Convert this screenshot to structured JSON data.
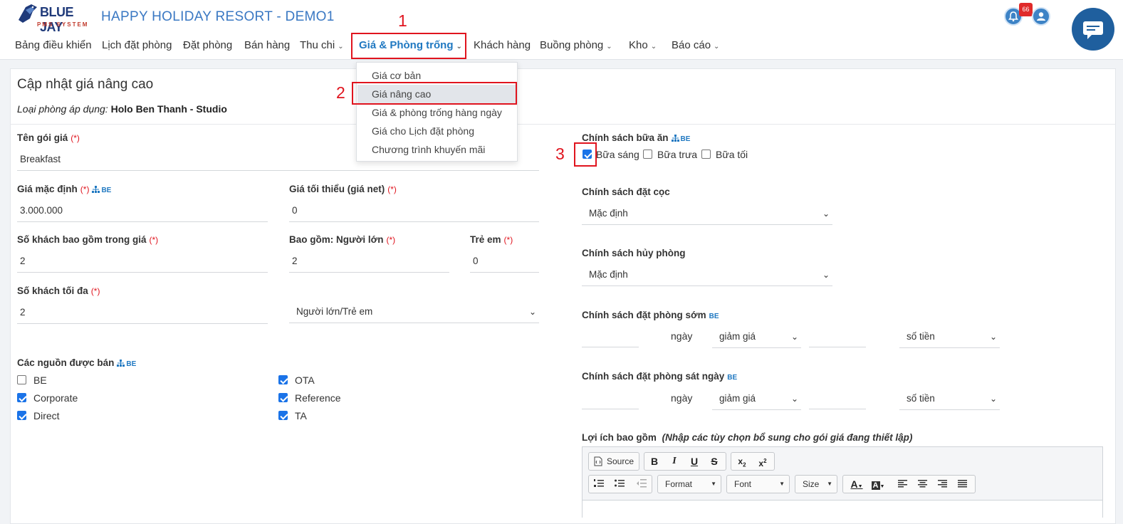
{
  "brand": {
    "logo_line1": "BLUE JAY",
    "logo_line2": "PMS SYSTEM",
    "site_title": "HAPPY HOLIDAY RESORT - DEMO1"
  },
  "nav": [
    {
      "label": "Bảng điều khiển"
    },
    {
      "label": "Lịch đặt phòng"
    },
    {
      "label": "Đặt phòng"
    },
    {
      "label": "Bán hàng"
    },
    {
      "label": "Thu chi"
    },
    {
      "label": "Giá & Phòng trống"
    },
    {
      "label": "Khách hàng"
    },
    {
      "label": "Buồng phòng"
    },
    {
      "label": "Kho"
    },
    {
      "label": "Báo cáo"
    }
  ],
  "notifications": {
    "count": "66"
  },
  "annotations": {
    "m1": "1",
    "m2": "2",
    "m3": "3"
  },
  "dropdown": {
    "items": [
      "Giá cơ bản",
      "Giá nâng cao",
      "Giá & phòng trống hàng ngày",
      "Giá cho Lịch đặt phòng",
      "Chương trình khuyến mãi"
    ]
  },
  "page": {
    "title": "Cập nhật giá nâng cao",
    "room_type_label": "Loại phòng áp dụng:",
    "room_type_value": "Holo Ben Thanh - Studio"
  },
  "common": {
    "required": "(*)",
    "be": "BE"
  },
  "form": {
    "package_name": {
      "label": "Tên gói giá",
      "value": "Breakfast"
    },
    "default_price": {
      "label": "Giá mặc định",
      "value": "3.000.000"
    },
    "min_price": {
      "label": "Giá tối thiểu (giá net)",
      "value": "0"
    },
    "guests_included": {
      "label": "Số khách bao gồm trong giá",
      "value": "2"
    },
    "adults_included": {
      "label": "Bao gồm: Người lớn",
      "value": "2"
    },
    "children": {
      "label": "Trẻ em",
      "value": "0"
    },
    "max_guests": {
      "label": "Số khách tối đa",
      "value": "2"
    },
    "guest_type": {
      "value": "Người lớn/Trẻ em"
    },
    "sources": {
      "label": "Các nguồn được bán",
      "items": [
        {
          "label": "BE",
          "checked": false
        },
        {
          "label": "Corporate",
          "checked": true
        },
        {
          "label": "Direct",
          "checked": true
        },
        {
          "label": "OTA",
          "checked": true
        },
        {
          "label": "Reference",
          "checked": true
        },
        {
          "label": "TA",
          "checked": true
        }
      ]
    }
  },
  "policies": {
    "meal": {
      "label": "Chính sách bữa ăn",
      "options": [
        {
          "label": "Bữa sáng",
          "checked": true
        },
        {
          "label": "Bữa trưa",
          "checked": false
        },
        {
          "label": "Bữa tối",
          "checked": false
        }
      ]
    },
    "deposit": {
      "label": "Chính sách đặt cọc",
      "value": "Mặc định"
    },
    "cancel": {
      "label": "Chính sách hủy phòng",
      "value": "Mặc định"
    },
    "early_booking": {
      "label": "Chính sách đặt phòng sớm",
      "days_label": "ngày",
      "discount": "giảm giá",
      "amount_type": "số tiền"
    },
    "late_booking": {
      "label": "Chính sách đặt phòng sát ngày",
      "days_label": "ngày",
      "discount": "giảm giá",
      "amount_type": "số tiền"
    }
  },
  "benefits": {
    "label": "Lợi ích bao gồm",
    "hint": "(Nhập các tùy chọn bổ sung cho gói giá đang thiết lập)"
  },
  "editor": {
    "source": "Source",
    "format": "Format",
    "font": "Font",
    "size": "Size"
  }
}
